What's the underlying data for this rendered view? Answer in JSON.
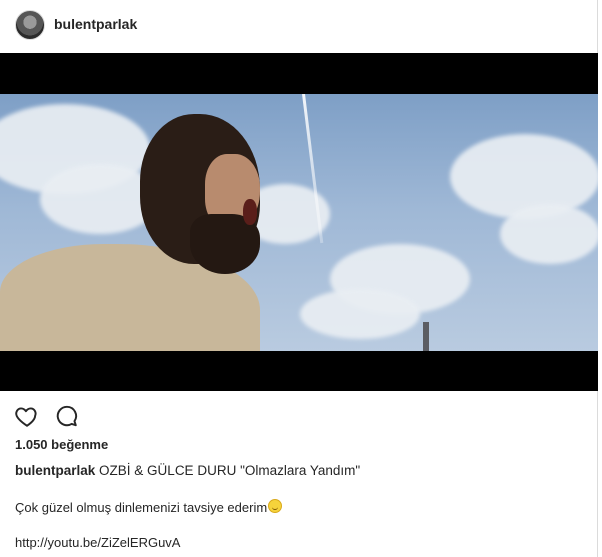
{
  "post": {
    "username": "bulentparlak",
    "likes_text": "1.050 beğenme",
    "caption_text": "OZBİ & GÜLCE DURU \"Olmazlara Yandım\"",
    "description": "Çok güzel olmuş dinlemenizi tavsiye ederim",
    "link": "http://youtu.be/ZiZelERGuvA"
  },
  "icons": {
    "like": "heart-icon",
    "comment": "comment-icon",
    "emoji": "smiling-face-emoji"
  },
  "colors": {
    "text": "#262626",
    "border": "#dbdbdb",
    "letterbox": "#000000"
  }
}
